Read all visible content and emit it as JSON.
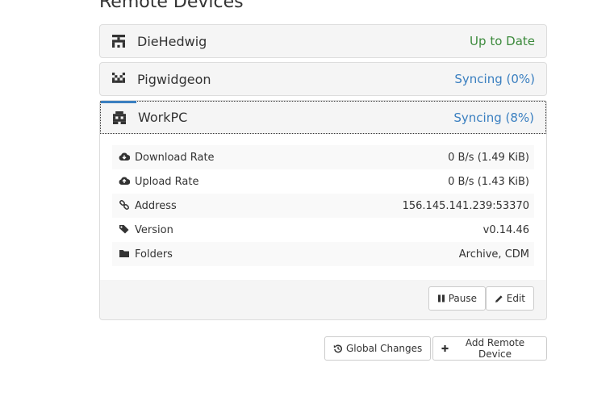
{
  "page": {
    "title": "Remote Devices"
  },
  "devices": [
    {
      "name": "DieHedwig",
      "status": "Up to Date",
      "status_color": "#3c8a3c",
      "icon": "identicon"
    },
    {
      "name": "Pigwidgeon",
      "status": "Syncing (0%)",
      "status_color": "#3a7fc0",
      "icon": "identicon"
    },
    {
      "name": "WorkPC",
      "status": "Syncing (8%)",
      "status_color": "#3a7fc0",
      "icon": "identicon",
      "sync_progress_percent": 8,
      "details": [
        {
          "icon": "cloud-download-icon",
          "label": "Download Rate",
          "value": "0 B/s (1.49 KiB)"
        },
        {
          "icon": "cloud-upload-icon",
          "label": "Upload Rate",
          "value": "0 B/s (1.43 KiB)"
        },
        {
          "icon": "link-icon",
          "label": "Address",
          "value": "156.145.141.239:53370"
        },
        {
          "icon": "tag-icon",
          "label": "Version",
          "value": "v0.14.46"
        },
        {
          "icon": "folder-icon",
          "label": "Folders",
          "value": "Archive, CDM"
        }
      ],
      "actions": {
        "pause": "Pause",
        "edit": "Edit"
      }
    }
  ],
  "footer_actions": {
    "global_changes": "Global Changes",
    "add_remote_device": "Add Remote Device"
  }
}
